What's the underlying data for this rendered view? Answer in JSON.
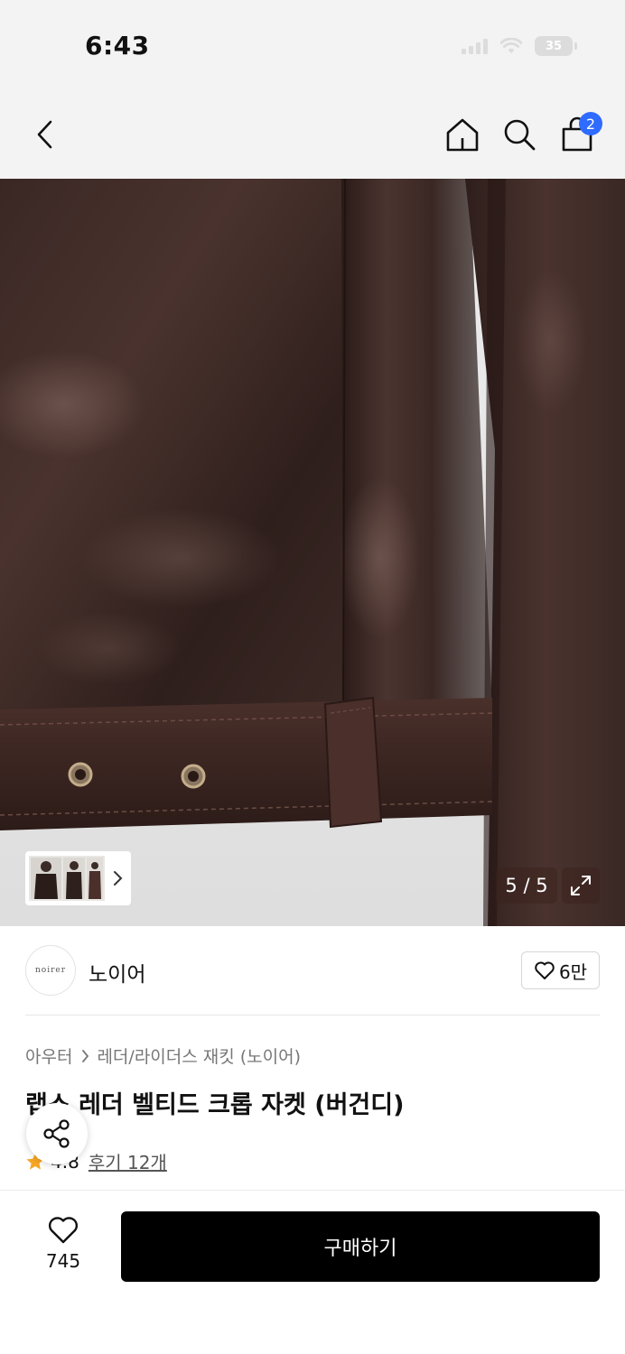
{
  "status_bar": {
    "time": "6:43",
    "battery": "35"
  },
  "nav": {
    "cart_count": "2"
  },
  "image": {
    "counter": "5 / 5"
  },
  "brand": {
    "logo_text": "noirer",
    "name": "노이어",
    "like_count": "6만"
  },
  "breadcrumb": {
    "category": "아우터",
    "subcategory": "레더/라이더스 재킷 (노이어)"
  },
  "product": {
    "title": "랩스 레더 벨티드 크롭 자켓 (버건디)",
    "rating": "4.8",
    "reviews": "후기 12개"
  },
  "bottom": {
    "wish_count": "745",
    "buy_label": "구매하기"
  },
  "colors": {
    "accent_badge": "#2f6bff",
    "leather": "#3a2622",
    "buy_button": "#000000",
    "star": "#f5a623"
  }
}
